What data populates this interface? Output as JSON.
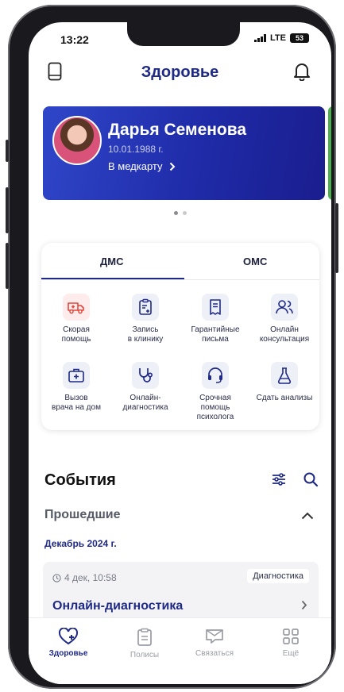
{
  "status": {
    "time": "13:22",
    "network": "LTE",
    "battery": "53"
  },
  "header": {
    "title": "Здоровье",
    "left_icon": "card-icon",
    "right_icon": "bell-icon"
  },
  "profile": {
    "name": "Дарья Семенова",
    "birthdate": "10.01.1988 г.",
    "link": "В медкарту"
  },
  "tabs": [
    {
      "label": "ДМС"
    },
    {
      "label": "ОМС"
    }
  ],
  "services": [
    {
      "label": "Скорая\nпомощь",
      "icon": "ambulance-icon"
    },
    {
      "label": "Запись\nв клинику",
      "icon": "clipboard-plus-icon"
    },
    {
      "label": "Гарантийные\nписьма",
      "icon": "document-icon"
    },
    {
      "label": "Онлайн\nконсультация",
      "icon": "people-icon"
    },
    {
      "label": "Вызов\nврача на дом",
      "icon": "medkit-icon"
    },
    {
      "label": "Онлайн-\nдиагностика",
      "icon": "stethoscope-icon"
    },
    {
      "label": "Срочная\nпомощь\nпсихолога",
      "icon": "headset-icon"
    },
    {
      "label": "Сдать анализы",
      "icon": "flask-icon"
    }
  ],
  "events": {
    "title": "События",
    "past_label": "Прошедшие",
    "month": "Декабрь 2024 г.",
    "item": {
      "time": "4 дек, 10:58",
      "badge": "Диагностика",
      "name": "Онлайн-диагностика"
    }
  },
  "nav": [
    {
      "label": "Здоровье",
      "icon": "heart-plus-icon"
    },
    {
      "label": "Полисы",
      "icon": "policy-icon"
    },
    {
      "label": "Связаться",
      "icon": "chat-icon"
    },
    {
      "label": "Ещё",
      "icon": "grid-icon"
    }
  ],
  "colors": {
    "brand": "#1f2a86",
    "card_gradient_start": "#2f46c9",
    "card_gradient_end": "#1a1d8e",
    "accent_red": "#e0473c"
  }
}
